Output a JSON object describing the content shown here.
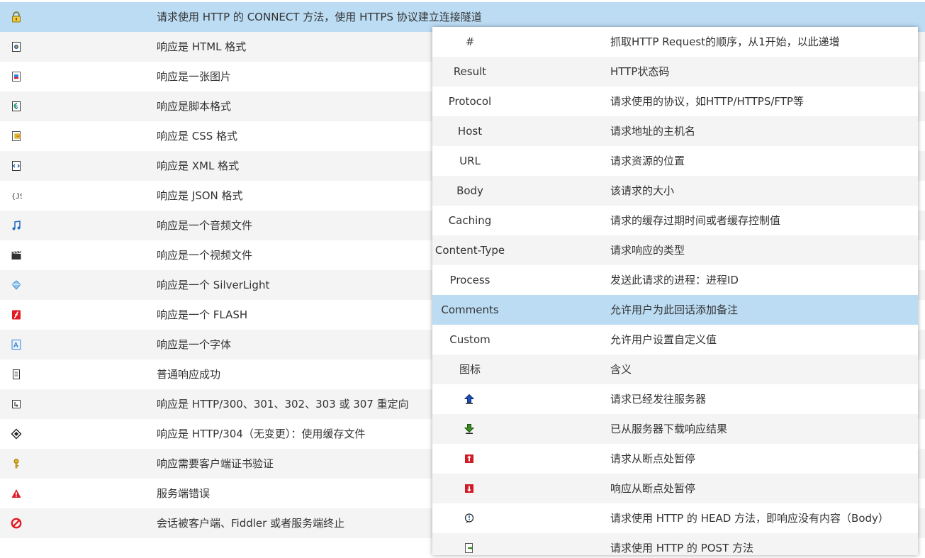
{
  "left_rows": [
    {
      "icon": "lock-icon",
      "text": "请求使用 HTTP 的 CONNECT 方法，使用 HTTPS 协议建立连接隧道",
      "selected": true
    },
    {
      "icon": "html-document-icon",
      "text": "响应是 HTML 格式"
    },
    {
      "icon": "image-file-icon",
      "text": "响应是一张图片"
    },
    {
      "icon": "script-file-icon",
      "text": "响应是脚本格式"
    },
    {
      "icon": "css-file-icon",
      "text": "响应是 CSS 格式"
    },
    {
      "icon": "xml-file-icon",
      "text": "响应是 XML 格式"
    },
    {
      "icon": "json-icon",
      "text": "响应是 JSON 格式"
    },
    {
      "icon": "music-note-icon",
      "text": "响应是一个音频文件"
    },
    {
      "icon": "video-clapper-icon",
      "text": "响应是一个视频文件"
    },
    {
      "icon": "silverlight-icon",
      "text": "响应是一个 SilverLight"
    },
    {
      "icon": "flash-icon",
      "text": "响应是一个 FLASH"
    },
    {
      "icon": "font-file-icon",
      "text": "响应是一个字体"
    },
    {
      "icon": "plain-document-icon",
      "text": "普通响应成功"
    },
    {
      "icon": "redirect-icon",
      "text": "响应是 HTTP/300、301、302、303 或 307 重定向"
    },
    {
      "icon": "cache-diamond-icon",
      "text": "响应是 HTTP/304（无变更）：使用缓存文件"
    },
    {
      "icon": "key-icon",
      "text": "响应需要客户端证书验证"
    },
    {
      "icon": "warning-triangle-icon",
      "text": "服务端错误"
    },
    {
      "icon": "prohibited-icon",
      "text": "会话被客户端、Fiddler 或者服务端终止"
    }
  ],
  "right_rows": [
    {
      "key": "#",
      "value": "抓取HTTP Request的顺序，从1开始，以此递增"
    },
    {
      "key": "Result",
      "value": "HTTP状态码"
    },
    {
      "key": "Protocol",
      "value": "请求使用的协议，如HTTP/HTTPS/FTP等"
    },
    {
      "key": "Host",
      "value": "请求地址的主机名"
    },
    {
      "key": "URL",
      "value": "请求资源的位置"
    },
    {
      "key": "Body",
      "value": "该请求的大小"
    },
    {
      "key": "Caching",
      "value": "请求的缓存过期时间或者缓存控制值"
    },
    {
      "key": "Content-Type",
      "value": "请求响应的类型"
    },
    {
      "key": "Process",
      "value": "发送此请求的进程：进程ID"
    },
    {
      "key": "Comments",
      "value": "允许用户为此回话添加备注",
      "selected": true
    },
    {
      "key": "Custom",
      "value": "允许用户设置自定义值"
    },
    {
      "key": "图标",
      "value": "含义"
    },
    {
      "icon": "upload-arrow-icon",
      "value": "请求已经发往服务器"
    },
    {
      "icon": "download-arrow-icon",
      "value": "已从服务器下载响应结果"
    },
    {
      "icon": "request-breakpoint-icon",
      "value": "请求从断点处暂停"
    },
    {
      "icon": "response-breakpoint-icon",
      "value": "响应从断点处暂停"
    },
    {
      "icon": "head-method-icon",
      "value": "请求使用 HTTP 的 HEAD 方法，即响应没有内容（Body）"
    },
    {
      "icon": "post-method-icon",
      "value": "请求使用 HTTP 的 POST 方法"
    }
  ],
  "colors": {
    "selected_row": "#bcdcf4",
    "alt_row": "#f4f4f4",
    "text": "#333333"
  }
}
